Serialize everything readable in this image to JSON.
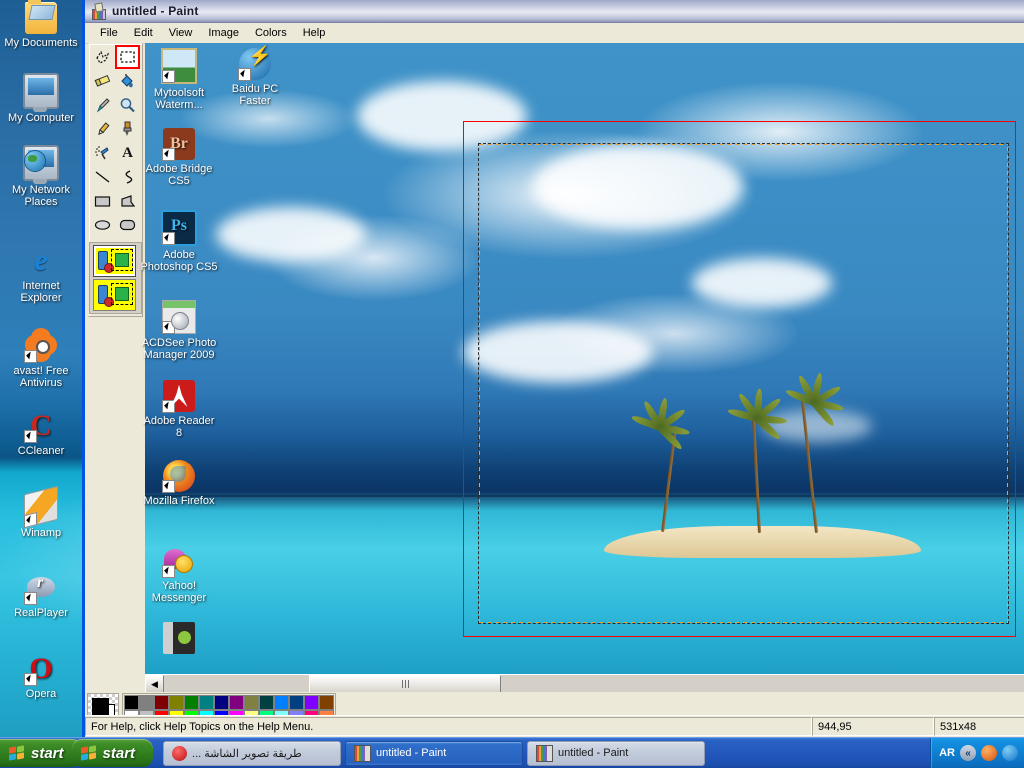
{
  "desktop": {
    "icons_col1": [
      {
        "label": "My Documents",
        "icon": "folder-documents-icon",
        "shortcut": false
      },
      {
        "label": "My Computer",
        "icon": "computer-icon",
        "shortcut": false
      },
      {
        "label": "My Network Places",
        "icon": "network-places-icon",
        "shortcut": false
      },
      {
        "label": "Internet Explorer",
        "icon": "internet-explorer-icon",
        "shortcut": false
      },
      {
        "label": "avast! Free Antivirus",
        "icon": "avast-icon",
        "shortcut": true
      },
      {
        "label": "CCleaner",
        "icon": "ccleaner-icon",
        "shortcut": true
      },
      {
        "label": "Winamp",
        "icon": "winamp-icon",
        "shortcut": true
      },
      {
        "label": "RealPlayer",
        "icon": "realplayer-icon",
        "shortcut": true
      },
      {
        "label": "Opera",
        "icon": "opera-icon",
        "shortcut": true
      }
    ],
    "icons_col2": [
      {
        "label": "Mytoolsoft Waterm...",
        "icon": "mytoolsoft-watermark-icon",
        "shortcut": true
      },
      {
        "label": "Adobe Bridge CS5",
        "icon": "adobe-bridge-icon",
        "shortcut": true
      },
      {
        "label": "Adobe Photoshop CS5",
        "icon": "adobe-photoshop-icon",
        "shortcut": true
      },
      {
        "label": "ACDSee Photo Manager 2009",
        "icon": "acdsee-icon",
        "shortcut": true
      },
      {
        "label": "Adobe Reader 8",
        "icon": "adobe-reader-icon",
        "shortcut": true
      },
      {
        "label": "Mozilla Firefox",
        "icon": "firefox-icon",
        "shortcut": true
      },
      {
        "label": "Yahoo! Messenger",
        "icon": "yahoo-messenger-icon",
        "shortcut": true
      },
      {
        "label": "",
        "icon": "usb-drive-icon",
        "shortcut": false
      }
    ],
    "icons_col3": [
      {
        "label": "Baidu PC Faster",
        "icon": "baidu-pc-faster-icon",
        "shortcut": true
      }
    ]
  },
  "paint": {
    "title": "untitled - Paint",
    "title_icon": "paint-palette-icon",
    "menus": [
      "File",
      "Edit",
      "View",
      "Image",
      "Colors",
      "Help"
    ],
    "tools": [
      {
        "name": "free-form-select-tool",
        "selected": false
      },
      {
        "name": "rectangular-select-tool",
        "selected": true
      },
      {
        "name": "eraser-tool",
        "selected": false
      },
      {
        "name": "fill-with-color-tool",
        "selected": false
      },
      {
        "name": "pick-color-tool",
        "selected": false
      },
      {
        "name": "magnifier-tool",
        "selected": false
      },
      {
        "name": "pencil-tool",
        "selected": false
      },
      {
        "name": "brush-tool",
        "selected": false
      },
      {
        "name": "airbrush-tool",
        "selected": false
      },
      {
        "name": "text-tool",
        "selected": false
      },
      {
        "name": "line-tool",
        "selected": false
      },
      {
        "name": "curve-tool",
        "selected": false
      },
      {
        "name": "rectangle-tool",
        "selected": false
      },
      {
        "name": "polygon-tool",
        "selected": false
      },
      {
        "name": "ellipse-tool",
        "selected": false
      },
      {
        "name": "rounded-rectangle-tool",
        "selected": false
      }
    ],
    "tool_options": [
      {
        "name": "opaque-selection-option",
        "active": true
      },
      {
        "name": "transparent-selection-option",
        "active": false
      }
    ],
    "status": {
      "help_text": "For Help, click Help Topics on the Help Menu.",
      "cursor_position": "944,95",
      "selection_size": "531x48"
    },
    "palette": {
      "foreground_color": "#000000",
      "background_color": "#ffffff",
      "row_top": [
        "#000000",
        "#808080",
        "#800000",
        "#808000",
        "#008000",
        "#008080",
        "#000080",
        "#800080",
        "#808040",
        "#004040",
        "#0080ff",
        "#004080",
        "#8000ff",
        "#804000"
      ],
      "row_bottom": [
        "#ffffff",
        "#c0c0c0",
        "#ff0000",
        "#ffff00",
        "#00ff00",
        "#00ffff",
        "#0000ff",
        "#ff00ff",
        "#ffff80",
        "#00ff80",
        "#80ffff",
        "#8080ff",
        "#ff0080",
        "#ff8040"
      ]
    },
    "scroll": {
      "left_arrow": "◀",
      "thumb_grip": "horizontal-scroll-thumb"
    },
    "canvas": {
      "image_description": "tropical island with three palm trees under blue sky with clouds",
      "red_rectangle": "red-selection-rectangle",
      "marching_ants": "dashed-selection-marquee"
    }
  },
  "taskbar": {
    "start_buttons": [
      {
        "label": "start",
        "name": "start-button-1"
      },
      {
        "label": "start",
        "name": "start-button-2"
      }
    ],
    "tasks": [
      {
        "label": "طريقة تصوير الشاشة ...",
        "icon": "opera-doc-icon",
        "active": false,
        "rtl": true
      },
      {
        "label": "untitled - Paint",
        "icon": "paint-palette-icon",
        "active": true,
        "rtl": false
      },
      {
        "label": "untitled - Paint",
        "icon": "paint-palette-icon",
        "active": false,
        "rtl": false
      }
    ],
    "tray": {
      "language": "AR",
      "expand_icon": "«",
      "icons": [
        {
          "name": "avast-tray-icon",
          "color": "#e8620c"
        },
        {
          "name": "messenger-tray-icon",
          "color": "#1f8fe0"
        }
      ]
    }
  }
}
